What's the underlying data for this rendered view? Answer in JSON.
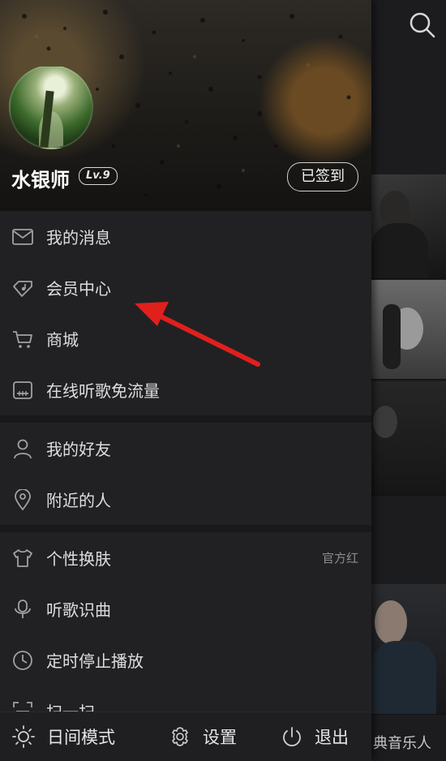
{
  "right_panel": {
    "footer_text": "典音乐人"
  },
  "profile": {
    "username": "水银师",
    "level": "Lv.9",
    "checkin_label": "已签到"
  },
  "menu": {
    "section1": [
      {
        "label": "我的消息",
        "icon": "mail-icon"
      },
      {
        "label": "会员中心",
        "icon": "diamond-music-icon"
      },
      {
        "label": "商城",
        "icon": "cart-icon"
      },
      {
        "label": "在线听歌免流量",
        "icon": "sim-card-icon"
      }
    ],
    "section2": [
      {
        "label": "我的好友",
        "icon": "person-icon"
      },
      {
        "label": "附近的人",
        "icon": "location-pin-icon"
      }
    ],
    "section3": [
      {
        "label": "个性换肤",
        "icon": "tshirt-icon",
        "value": "官方红"
      },
      {
        "label": "听歌识曲",
        "icon": "microphone-icon"
      },
      {
        "label": "定时停止播放",
        "icon": "clock-icon"
      },
      {
        "label": "扫一扫",
        "icon": "scan-icon"
      }
    ]
  },
  "footer": {
    "night_mode_label": "日间模式",
    "settings_label": "设置",
    "exit_label": "退出"
  },
  "colors": {
    "drawer_bg": "#212124",
    "annotation_arrow": "#e0201c"
  }
}
